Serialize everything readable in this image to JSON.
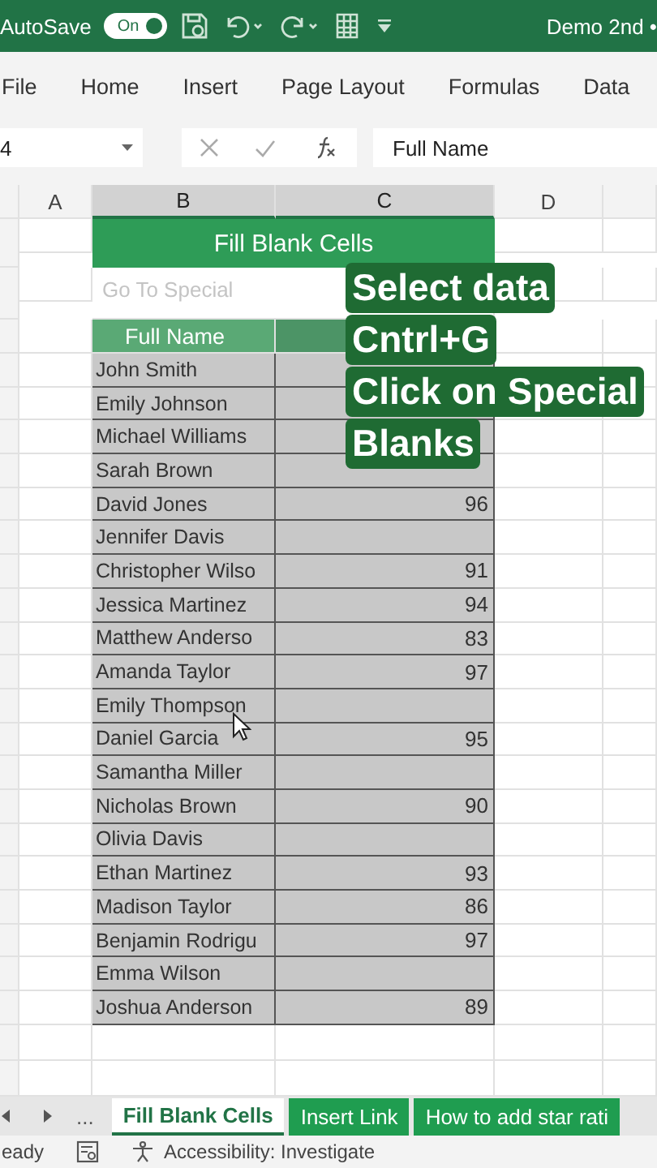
{
  "title_bar": {
    "autosave_label": "AutoSave",
    "autosave": {
      "label": "On",
      "on": true
    },
    "document_title": "Demo 2nd •"
  },
  "ribbon_tabs": [
    {
      "label": "File"
    },
    {
      "label": "Home"
    },
    {
      "label": "Insert"
    },
    {
      "label": "Page Layout"
    },
    {
      "label": "Formulas"
    },
    {
      "label": "Data"
    }
  ],
  "formula_bar": {
    "name_box": "4",
    "content": "Full Name"
  },
  "columns": [
    {
      "label": "A",
      "selected": false
    },
    {
      "label": "B",
      "selected": true
    },
    {
      "label": "C",
      "selected": true
    },
    {
      "label": "D",
      "selected": false
    }
  ],
  "sheet": {
    "table_title": "Fill Blank Cells",
    "dialog_title": "Go To Special",
    "header": "Full Name",
    "rows": [
      {
        "name": "John Smith"
      },
      {
        "name": "Emily Johnson"
      },
      {
        "name": "Michael Williams"
      },
      {
        "name": "Sarah Brown"
      },
      {
        "name": "David Jones",
        "score": "96"
      },
      {
        "name": "Jennifer Davis"
      },
      {
        "name": "Christopher Wilso",
        "score": "91"
      },
      {
        "name": "Jessica Martinez",
        "score": "94"
      },
      {
        "name": "Matthew Anderso",
        "score": "83"
      },
      {
        "name": "Amanda Taylor",
        "score": "97"
      },
      {
        "name": "Emily Thompson"
      },
      {
        "name": "Daniel Garcia",
        "score": "95"
      },
      {
        "name": "Samantha Miller"
      },
      {
        "name": "Nicholas Brown",
        "score": "90"
      },
      {
        "name": "Olivia Davis"
      },
      {
        "name": "Ethan Martinez",
        "score": "93"
      },
      {
        "name": "Madison Taylor",
        "score": "86"
      },
      {
        "name": "Benjamin Rodrigu",
        "score": "97"
      },
      {
        "name": "Emma Wilson"
      },
      {
        "name": "Joshua Anderson",
        "score": "89"
      }
    ]
  },
  "callout": {
    "lines": [
      "Select data",
      "Cntrl+G",
      "Click on Special",
      "Blanks"
    ]
  },
  "sheet_tabs": {
    "more": "...",
    "tabs": [
      {
        "label": "Fill Blank Cells",
        "selected": true
      },
      {
        "label": "Insert Link",
        "selected": false
      },
      {
        "label": "How to add star rati",
        "selected": false
      }
    ]
  },
  "status_bar": {
    "mode": "eady",
    "accessibility": "Accessibility: Investigate"
  }
}
